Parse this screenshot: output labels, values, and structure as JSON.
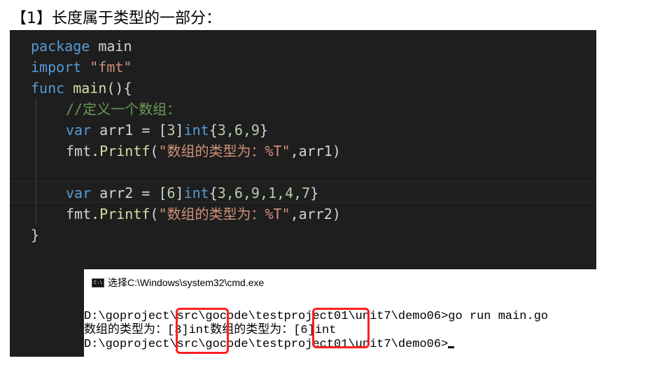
{
  "heading": "【1】长度属于类型的一部分：",
  "code": {
    "l1_kw": "package",
    "l1_rest": " main",
    "l2_kw": "import",
    "l2_str": " \"fmt\"",
    "l3_kw": "func",
    "l3_fn": " main",
    "l3_rest": "(){",
    "l4_cmt": "//定义一个数组：",
    "l5_kw": "var",
    "l5_a": " arr1 = [",
    "l5_n": "3",
    "l5_b": "]",
    "l5_type": "int",
    "l5_c": "{",
    "l5_vals": "3,6,9",
    "l5_d": "}",
    "l6_a": "fmt.",
    "l6_fn": "Printf",
    "l6_b": "(",
    "l6_str": "\"数组的类型为：%T\"",
    "l6_c": ",arr1)",
    "l8_kw": "var",
    "l8_a": " arr2 = [",
    "l8_n": "6",
    "l8_b": "]",
    "l8_type": "int",
    "l8_c": "{",
    "l8_vals": "3,6,9,1,4,7",
    "l8_d": "}",
    "l9_a": "fmt.",
    "l9_fn": "Printf",
    "l9_b": "(",
    "l9_str": "\"数组的类型为：%T\"",
    "l9_c": ",arr2)",
    "l10": "}"
  },
  "cmd": {
    "title": "选择C:\\Windows\\system32\\cmd.exe",
    "icon_label": "C:\\",
    "line1": "D:\\goproject\\src\\gocode\\testproject01\\unit7\\demo06>go run main.go",
    "line2": "数组的类型为：[3]int数组的类型为：[6]int",
    "line3": "D:\\goproject\\src\\gocode\\testproject01\\unit7\\demo06>"
  },
  "colors": {
    "editor_bg": "#1e1e1e",
    "keyword": "#569cd6",
    "string": "#ce9178",
    "comment": "#6a9955",
    "function": "#dcdcaa",
    "number": "#b5cea8",
    "highlight_box": "#ff1f1f"
  },
  "icons": {
    "cmd": "console-window-icon"
  }
}
